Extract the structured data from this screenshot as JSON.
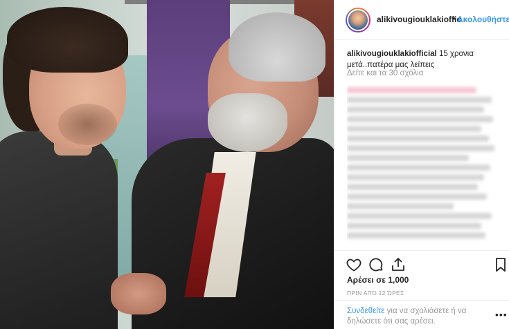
{
  "header": {
    "username": "alikivougiouklakioffic",
    "separator": "•",
    "follow_label": "Ακολουθήστε"
  },
  "caption": {
    "username": "alikivougiouklakiofficial",
    "text": "15 χρονια μετά..πατέρα μας λείπεις"
  },
  "comments": {
    "view_all_label": "Δείτε και τα 30 σχόλια"
  },
  "actions": {
    "icons": [
      "heart-icon",
      "comment-icon",
      "share-icon",
      "bookmark-icon"
    ]
  },
  "likes": {
    "label": "Αρέσει σε 1,000"
  },
  "timestamp": "ΠΡΙΝ ΑΠΌ 12 ΏΡΕΣ",
  "comment_bar": {
    "login_link": "Συνδεθείτε",
    "login_text": "για να σχολιάσετε ή να δηλώσετε ότι σας αρέσει.",
    "more_label": "•••"
  },
  "colors": {
    "accent": "#3897f0",
    "text": "#262626",
    "muted": "#999999",
    "border": "#efefef"
  }
}
